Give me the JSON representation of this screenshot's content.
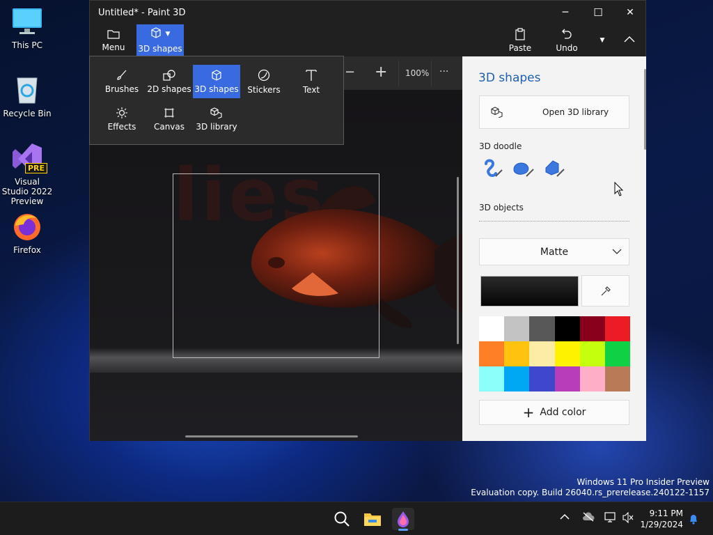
{
  "desktop": {
    "icons": [
      {
        "label": "This PC"
      },
      {
        "label": "Recycle Bin"
      },
      {
        "label": "Visual Studio 2022 Preview",
        "badge": "PRE"
      },
      {
        "label": "Firefox"
      }
    ],
    "watermark": {
      "line1": "Windows 11 Pro Insider Preview",
      "line2": "Evaluation copy. Build 26040.rs_prerelease.240122-1157"
    }
  },
  "window": {
    "title": "Untitled* - Paint 3D",
    "controls": {
      "minimize": "─",
      "maximize": "☐",
      "close": "✕"
    }
  },
  "ribbon": {
    "menu_label": "Menu",
    "shapes_label": "3D shapes",
    "paste_label": "Paste",
    "undo_label": "Undo"
  },
  "toolbar": {
    "zoom_out": "−",
    "zoom_in": "+",
    "zoom_level": "100%",
    "more": "···"
  },
  "dropdown": {
    "items": [
      {
        "label": "Brushes",
        "icon": "brush-icon"
      },
      {
        "label": "2D shapes",
        "icon": "2d-shapes-icon"
      },
      {
        "label": "3D shapes",
        "icon": "cube-icon",
        "active": true
      },
      {
        "label": "Stickers",
        "icon": "sticker-icon"
      },
      {
        "label": "Text",
        "icon": "text-icon"
      },
      {
        "label": "Effects",
        "icon": "effects-icon"
      },
      {
        "label": "Canvas",
        "icon": "canvas-icon"
      },
      {
        "label": "3D library",
        "icon": "3d-library-icon"
      }
    ]
  },
  "canvas": {
    "text": "lies"
  },
  "panel": {
    "title": "3D shapes",
    "open_library": "Open 3D library",
    "doodle_label": "3D doodle",
    "objects_label": "3D objects",
    "material": "Matte",
    "add_color": "Add color",
    "accent": "#3a6ae0",
    "swatches": [
      "#ffffff",
      "#c3c3c3",
      "#585858",
      "#000000",
      "#88001b",
      "#ec1c24",
      "#ff7f27",
      "#ffc20e",
      "#fdeca6",
      "#fff200",
      "#c4ff0e",
      "#0ed145",
      "#8cfffb",
      "#00a8f3",
      "#3f48cc",
      "#b83dba",
      "#ffaec8",
      "#b97a57"
    ]
  },
  "taskbar": {
    "time": "9:11 PM",
    "date": "1/29/2024"
  }
}
